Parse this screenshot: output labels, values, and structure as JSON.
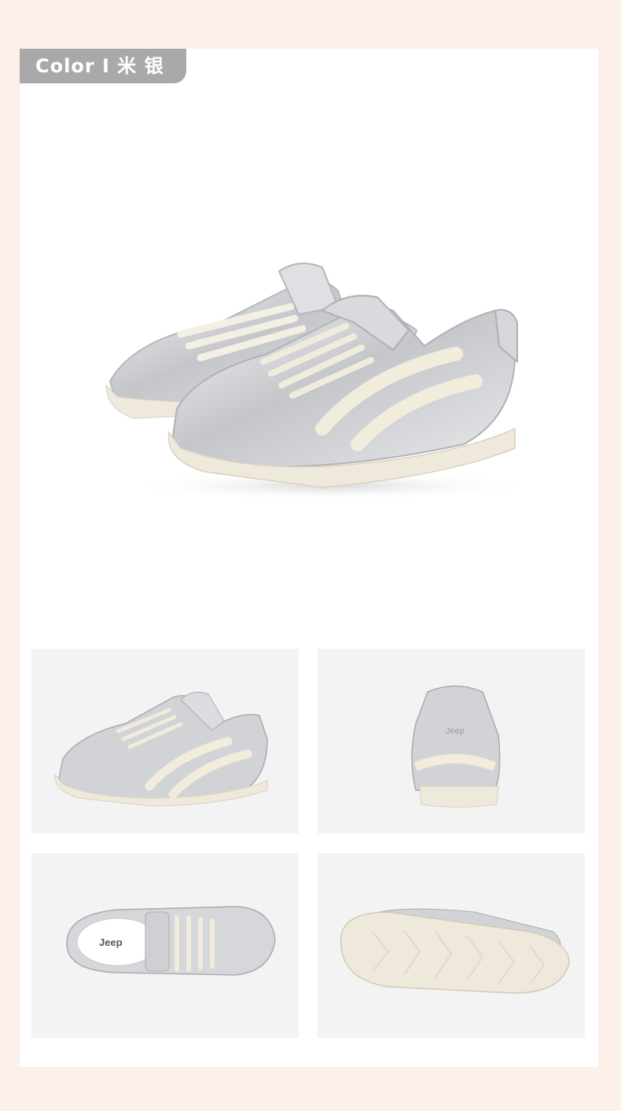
{
  "header": {
    "color_label": "Color I  米 银"
  },
  "product": {
    "hero_alt": "silver-sneaker-pair",
    "views": [
      "side-view",
      "back-view",
      "top-view",
      "sole-view"
    ]
  },
  "insole_logo": "Jeep",
  "heel_logo": "Jeep",
  "colors": {
    "page_bg": "#fbf1ea",
    "card_bg": "#ffffff",
    "tag_bg": "#a9a9a9",
    "panel_bg": "#f3f3f3",
    "silver": "#cfd0d3",
    "cream": "#efe9dc"
  }
}
